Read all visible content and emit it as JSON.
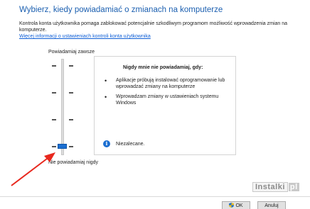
{
  "dialog": {
    "title": "Wybierz, kiedy powiadamiać o zmianach na komputerze",
    "description": "Kontrola konta użytkownika pomaga zablokować potencjalnie szkodliwym programom możliwość wprowadzenia zmian na komputerze.",
    "more_info_link": "Więcej informacji o ustawieniach kontroli konta użytkownika"
  },
  "slider": {
    "top_label": "Powiadamiaj zawsze",
    "bottom_label": "Nie powiadamiaj nigdy",
    "levels": 4,
    "selected_level": 1
  },
  "info_box": {
    "title": "Nigdy mnie nie powiadamiaj, gdy:",
    "bullets": [
      "Aplikacje próbują instalować oprogramowanie lub wprowadzać zmiany na komputerze",
      "Wprowadzam zmiany w ustawieniach systemu Windows"
    ],
    "note": "Niezalecane.",
    "note_icon": "info-icon"
  },
  "footer": {
    "ok_label": "OK",
    "cancel_label": "Anuluj",
    "ok_icon": "shield-icon"
  },
  "watermark": {
    "text": "Instalki",
    "suffix": "pl"
  },
  "colors": {
    "title": "#1b5fb0",
    "link": "#0f5fd6",
    "slider_thumb": "#1c6fd1",
    "arrow": "#e8281e"
  }
}
